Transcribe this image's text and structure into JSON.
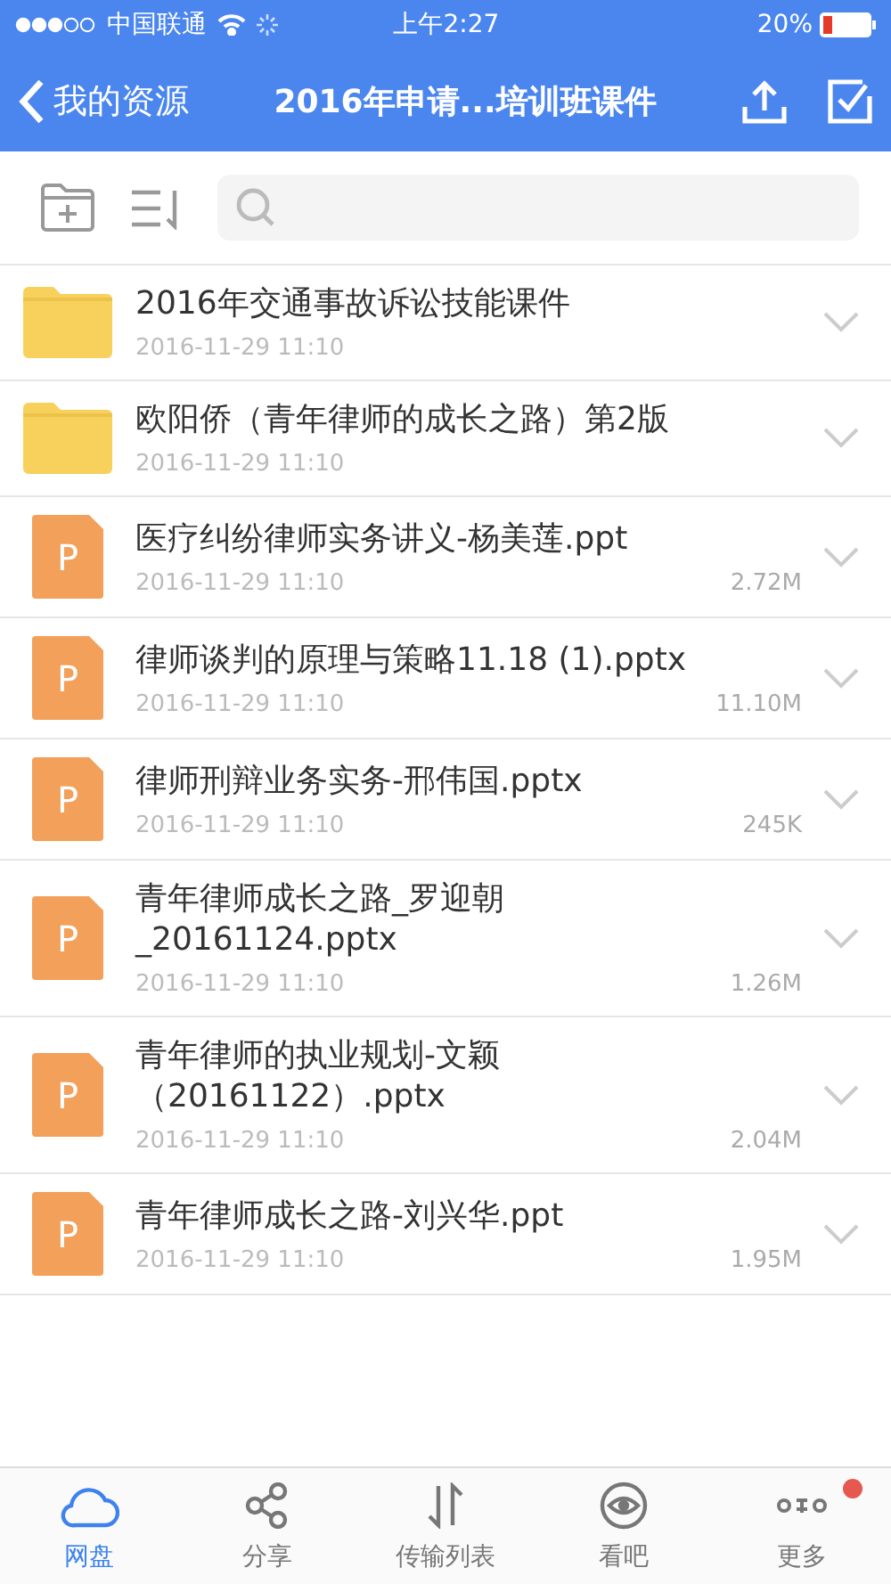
{
  "status_bar": {
    "carrier": "中国联通",
    "time": "上午2:27",
    "battery": "20%"
  },
  "nav": {
    "back": "我的资源",
    "title": "2016年申请...培训班课件"
  },
  "files": [
    {
      "kind": "folder",
      "name": "2016年交通事故诉讼技能课件",
      "date": "2016-11-29 11:10"
    },
    {
      "kind": "folder",
      "name": "欧阳侨（青年律师的成长之路）第2版",
      "date": "2016-11-29 11:10"
    },
    {
      "kind": "ppt",
      "badge": "P",
      "name": "医疗纠纷律师实务讲义-杨美莲.ppt",
      "date": "2016-11-29 11:10",
      "size": "2.72M"
    },
    {
      "kind": "ppt",
      "badge": "P",
      "name": "律师谈判的原理与策略11.18 (1).pptx",
      "date": "2016-11-29 11:10",
      "size": "11.10M"
    },
    {
      "kind": "ppt",
      "badge": "P",
      "name": "律师刑辩业务实务-邢伟国.pptx",
      "date": "2016-11-29 11:10",
      "size": "245K"
    },
    {
      "kind": "ppt",
      "badge": "P",
      "name": "青年律师成长之路_罗迎朝_20161124.pptx",
      "date": "2016-11-29 11:10",
      "size": "1.26M"
    },
    {
      "kind": "ppt",
      "badge": "P",
      "name": "青年律师的执业规划-文颖（20161122）.pptx",
      "date": "2016-11-29 11:10",
      "size": "2.04M"
    },
    {
      "kind": "ppt",
      "badge": "P",
      "name": "青年律师成长之路-刘兴华.ppt",
      "date": "2016-11-29 11:10",
      "size": "1.95M"
    }
  ],
  "tabs": [
    {
      "label": "网盘",
      "kind": "cloud",
      "selected": true,
      "dot": false
    },
    {
      "label": "分享",
      "kind": "share",
      "selected": false,
      "dot": false
    },
    {
      "label": "传输列表",
      "kind": "transfer",
      "selected": false,
      "dot": false
    },
    {
      "label": "看吧",
      "kind": "eye",
      "selected": false,
      "dot": false
    },
    {
      "label": "更多",
      "kind": "more",
      "selected": false,
      "dot": true
    }
  ]
}
